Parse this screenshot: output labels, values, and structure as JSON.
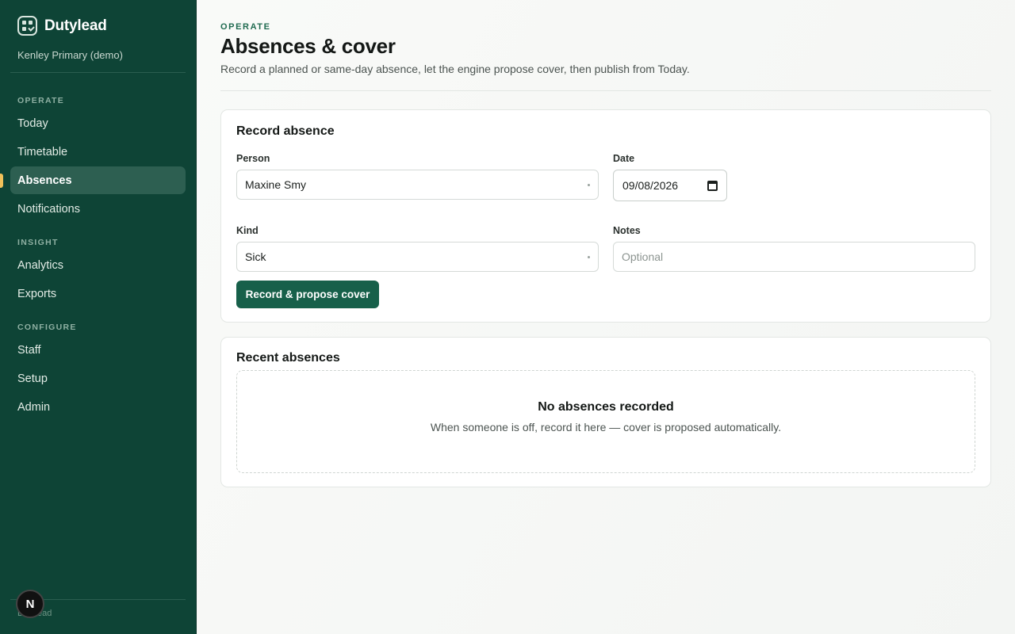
{
  "app": {
    "name": "Dutylead",
    "school": "Kenley Primary (demo)",
    "footer": "Dutylead",
    "badge": "N"
  },
  "nav": {
    "sections": [
      {
        "label": "OPERATE",
        "items": [
          "Today",
          "Timetable",
          "Absences",
          "Notifications"
        ]
      },
      {
        "label": "INSIGHT",
        "items": [
          "Analytics",
          "Exports"
        ]
      },
      {
        "label": "CONFIGURE",
        "items": [
          "Staff",
          "Setup",
          "Admin"
        ]
      }
    ],
    "active": "Absences"
  },
  "header": {
    "eyebrow": "OPERATE",
    "title": "Absences & cover",
    "subtitle": "Record a planned or same-day absence, let the engine propose cover, then publish from Today."
  },
  "record_form": {
    "title": "Record absence",
    "person_label": "Person",
    "person_value": "Maxine Smy",
    "date_label": "Date",
    "date_value": "09/08/2026",
    "kind_label": "Kind",
    "kind_value": "Sick",
    "notes_label": "Notes",
    "notes_placeholder": "Optional",
    "submit_label": "Record & propose cover"
  },
  "recent": {
    "title": "Recent absences",
    "empty_title": "No absences recorded",
    "empty_text": "When someone is off, record it here — cover is proposed automatically."
  },
  "colors": {
    "sidebar": "#0e4436",
    "accent": "#17604a",
    "active_marker": "#f0c15a"
  }
}
